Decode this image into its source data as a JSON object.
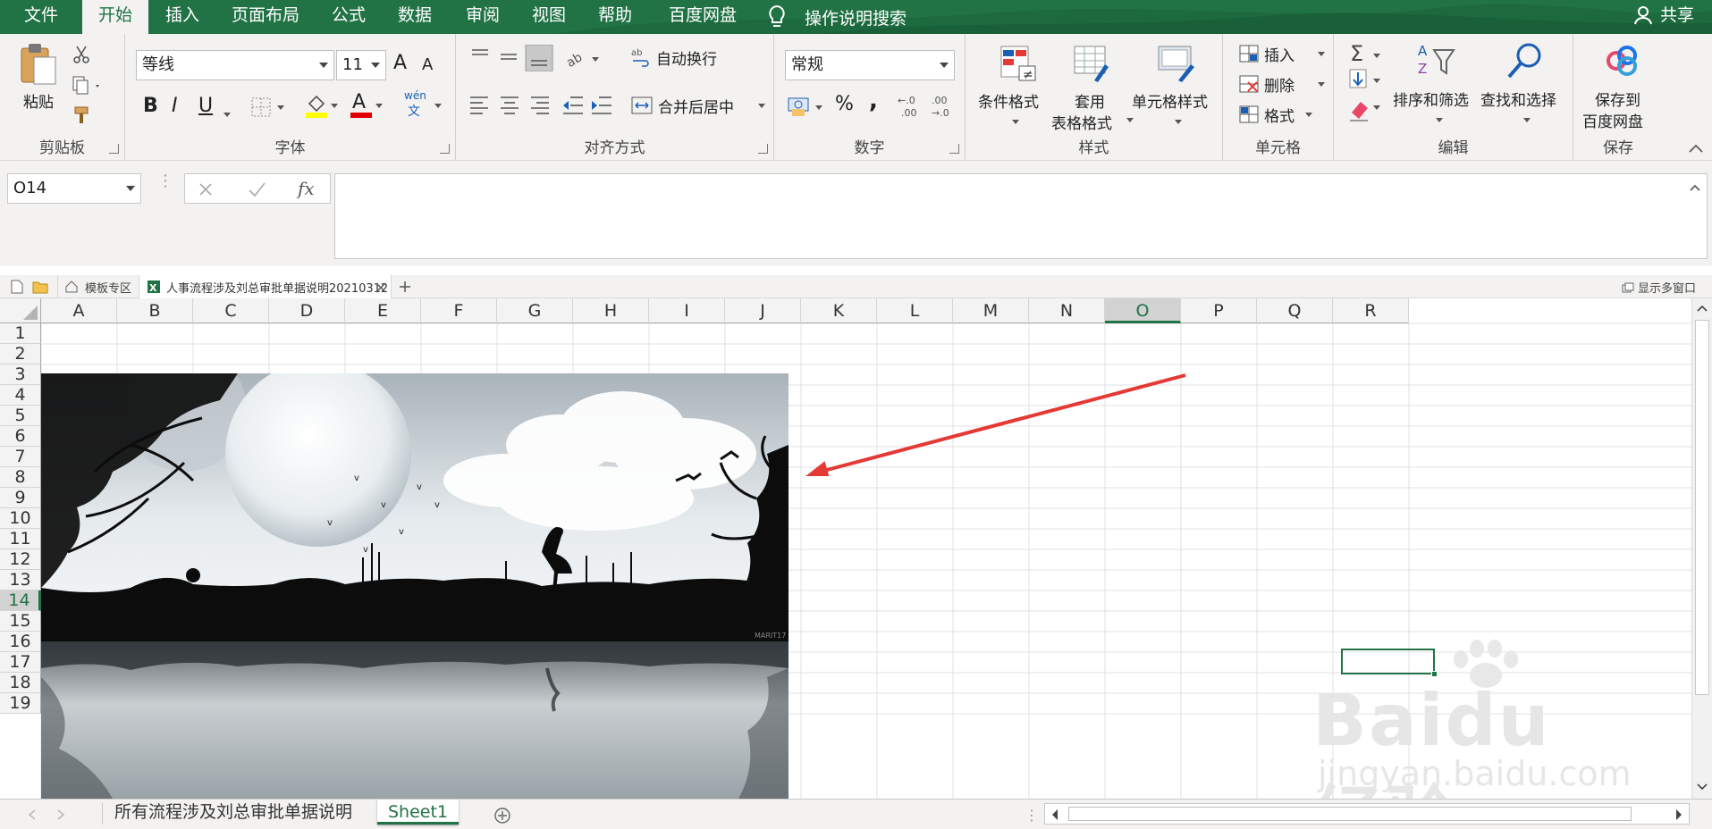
{
  "menu": {
    "tabs": [
      "文件",
      "开始",
      "插入",
      "页面布局",
      "公式",
      "数据",
      "审阅",
      "视图",
      "帮助",
      "百度网盘"
    ],
    "active_index": 1,
    "search": "操作说明搜索",
    "share": "共享"
  },
  "ribbon": {
    "clipboard": {
      "paste": "粘贴",
      "label": "剪贴板"
    },
    "font": {
      "name": "等线",
      "size": "11",
      "bold": "B",
      "italic": "I",
      "underline": "U",
      "grow": "A",
      "shrink": "A",
      "font_color": "A",
      "phonetic": "wén",
      "label": "字体"
    },
    "alignment": {
      "wrap": "自动换行",
      "merge": "合并后居中",
      "label": "对齐方式"
    },
    "number": {
      "format": "常规",
      "percent": "%",
      "comma": ",",
      "label": "数字"
    },
    "styles": {
      "conditional": "条件格式",
      "table1": "套用",
      "table2": "表格格式",
      "cell_styles": "单元格样式",
      "label": "样式"
    },
    "cells": {
      "insert": "插入",
      "delete": "删除",
      "format": "格式",
      "label": "单元格"
    },
    "editing": {
      "sort": "排序和筛选",
      "find": "查找和选择",
      "label": "编辑"
    },
    "save": {
      "line1": "保存到",
      "line2": "百度网盘",
      "label": "保存"
    }
  },
  "formula_bar": {
    "name_box": "O14",
    "fx": "fx",
    "value": ""
  },
  "file_tabs": {
    "template": "模板专区",
    "file": "人事流程涉及刘总审批单据说明20210312",
    "multi_window": "显示多窗口"
  },
  "grid": {
    "columns": [
      "A",
      "B",
      "C",
      "D",
      "E",
      "F",
      "G",
      "H",
      "I",
      "J",
      "K",
      "L",
      "M",
      "N",
      "O",
      "P",
      "Q",
      "R"
    ],
    "rows": [
      "1",
      "2",
      "3",
      "4",
      "5",
      "6",
      "7",
      "8",
      "9",
      "10",
      "11",
      "12",
      "13",
      "14",
      "15",
      "16",
      "17",
      "18",
      "19"
    ],
    "selected_cell": "O14",
    "image_caption": "MARIT17"
  },
  "sheets": {
    "tabs": [
      "所有流程涉及刘总审批单据说明",
      "Sheet1"
    ],
    "active_index": 1
  },
  "watermark": {
    "brand": "Baidu",
    "cn": "经验",
    "url": "jingyan.baidu.com"
  },
  "colors": {
    "excel_green": "#217346",
    "arrow": "#e53935"
  }
}
